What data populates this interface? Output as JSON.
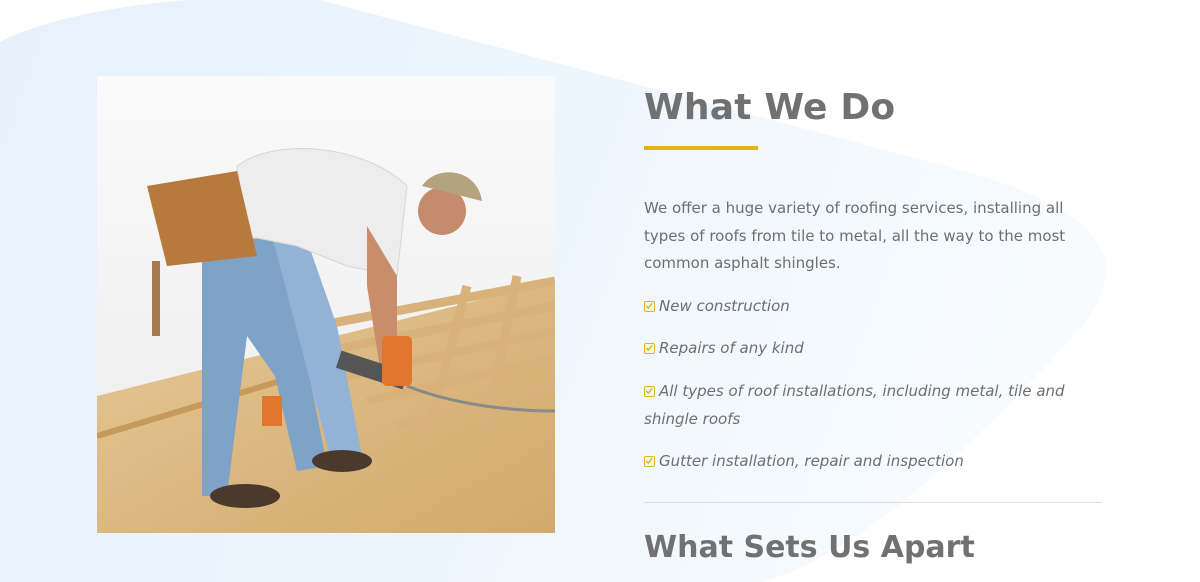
{
  "section": {
    "title": "What We Do",
    "intro": "We offer a huge variety of roofing services, installing all types of roofs from tile to metal, all the way to the most common asphalt shingles.",
    "services": [
      "New construction",
      "Repairs of any kind",
      "All types of roof installations, including metal, tile and shingle roofs",
      "Gutter installation, repair and inspection"
    ],
    "next_title": "What Sets Us Apart"
  },
  "icons": {
    "list_bullet": "check-square-icon"
  },
  "colors": {
    "accent": "#e3b417",
    "heading": "#717171",
    "body_text": "#6e6e6e",
    "background_tint": "#eaf4fd",
    "divider": "#dddddd"
  }
}
